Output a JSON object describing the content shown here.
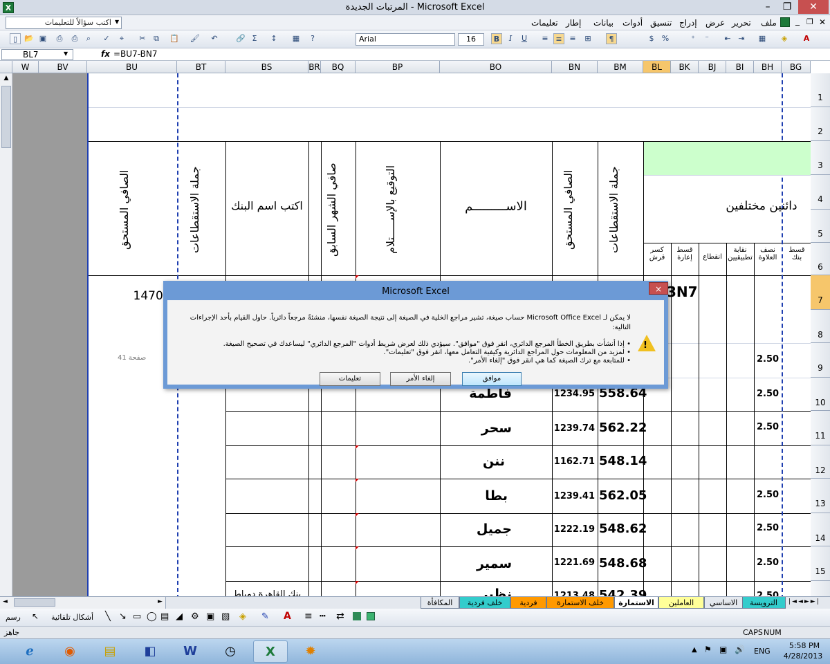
{
  "window": {
    "title": "المرتبات الجديدة - Microsoft Excel",
    "app_icon": "X",
    "min": "–",
    "max": "❐",
    "close": "✕"
  },
  "menu": {
    "items": [
      "ملف",
      "تحرير",
      "عرض",
      "إدراج",
      "تنسيق",
      "أدوات",
      "بيانات",
      "إطار",
      "تعليمات"
    ],
    "ask_placeholder": "اكتب سؤالاً للتعليمات"
  },
  "toolbar": {
    "font": "Arial",
    "size": "16",
    "bold": "B",
    "italic": "I",
    "underline": "U",
    "currency": "$",
    "percent": "%",
    "sum": "Σ"
  },
  "formula_bar": {
    "name_box": "BL7",
    "fx": "fx",
    "formula": "=BU7-BN7"
  },
  "columns": [
    {
      "id": "W",
      "label": "W"
    },
    {
      "id": "BV",
      "label": "BV"
    },
    {
      "id": "BU",
      "label": "BU"
    },
    {
      "id": "BT",
      "label": "BT"
    },
    {
      "id": "BS",
      "label": "BS"
    },
    {
      "id": "BR",
      "label": "BR"
    },
    {
      "id": "BQ",
      "label": "BQ"
    },
    {
      "id": "BP",
      "label": "BP"
    },
    {
      "id": "BO",
      "label": "BO"
    },
    {
      "id": "BN",
      "label": "BN"
    },
    {
      "id": "BM",
      "label": "BM"
    },
    {
      "id": "BL",
      "label": "BL"
    },
    {
      "id": "BK",
      "label": "BK"
    },
    {
      "id": "BJ",
      "label": "BJ"
    },
    {
      "id": "BI",
      "label": "BI"
    },
    {
      "id": "BH",
      "label": "BH"
    },
    {
      "id": "BG",
      "label": "BG"
    }
  ],
  "rows": [
    "1",
    "2",
    "3",
    "4",
    "5",
    "6",
    "7",
    "8",
    "9",
    "10",
    "11",
    "12",
    "13",
    "14",
    "15"
  ],
  "headers": {
    "net_due_bu": "الصافي المستحق",
    "total_deductions_bt": "جملة الاستقطاعات",
    "bank_name": "اكتب اسم البنك",
    "net_prev_month": "صافي الشهر السابق",
    "receipt_signature": "التوقيع بالإســـــتلام",
    "name_header": "الاســـــــــم",
    "net_due_bn": "الصافي المستحق",
    "total_deductions_bm": "جملة الاستقطاعات",
    "creditors": "دائنين مختلفين",
    "loan_break": "كسر قرش",
    "rent_installment": "قسط إعارة",
    "cutoff": "انقطاع",
    "applied_union": "نقابة تطبيقيين",
    "half_bonus": "نصف العلاوة",
    "bank_installment": "قسط بنك"
  },
  "cells": {
    "bu7": "1470.0",
    "bl7_partial": "3N7",
    "page_label": "صفحة 41",
    "bs16_partial": "بنك القاهرة دمياط",
    "row16_name_partial": "نظير"
  },
  "data_rows": [
    {
      "row": "9",
      "name": "",
      "bn": "",
      "bm": "",
      "bh": "2.50"
    },
    {
      "row": "10",
      "name": "فاطمة",
      "bn": "1234.95",
      "bm": "558.64",
      "bh": "2.50"
    },
    {
      "row": "11",
      "name": "سحر",
      "bn": "1239.74",
      "bm": "562.22",
      "bh": "2.50"
    },
    {
      "row": "12",
      "name": "ننن",
      "bn": "1162.71",
      "bm": "548.14",
      "bh": ""
    },
    {
      "row": "13",
      "name": "بطا",
      "bn": "1239.41",
      "bm": "562.05",
      "bh": "2.50"
    },
    {
      "row": "14",
      "name": "جميل",
      "bn": "1222.19",
      "bm": "548.62",
      "bh": "2.50"
    },
    {
      "row": "15",
      "name": "سمير",
      "bn": "1221.69",
      "bm": "548.68",
      "bh": "2.50"
    },
    {
      "row": "16",
      "name": "",
      "bn": "1213.48",
      "bm": "542.39",
      "bh": "2.50"
    }
  ],
  "dialog": {
    "title": "Microsoft Excel",
    "close": "×",
    "line1": "لا يمكن لـ Microsoft Office Excel حساب صيغة، تشير مراجع الخلية في الصيغة إلى نتيجة الصيغة نفسها، منشئةً مرجعاً دائرياً. حاول القيام بأحد الإجراءات",
    "line2": "التالية:",
    "bullet1": "• إذا أنشأت بطريق الخطأ المرجع الدائري، انقر فوق \"موافق\". سيؤدي ذلك لعرض شريط أدوات \"المرجع الدائري\" ليساعدك في تصحيح الصيغة.",
    "bullet2": "• لمزيد من المعلومات حول المراجع الدائرية وكيفية التعامل معها، انقر فوق \"تعليمات\".",
    "bullet3": "• للمتابعة مع ترك الصيغة كما هي انقر فوق \"إلغاء الأمر\".",
    "ok": "موافق",
    "cancel": "إلغاء الأمر",
    "help": "تعليمات"
  },
  "sheet_tabs": [
    "الترويسة",
    "الاساسي",
    "العاملين",
    "الاستمارة",
    "خلف الاستمارة",
    "فردية",
    "خلف فردية",
    "المكافأة"
  ],
  "active_tab": "الاستمارة",
  "drawbar": {
    "draw": "رسم",
    "autoshapes": "أشكال تلقائية"
  },
  "status": {
    "ready": "جاهز",
    "caps": "CAPS",
    "num": "NUM"
  },
  "taskbar": {
    "apps": [
      "ie-icon",
      "firefox-icon",
      "explorer-icon",
      "presentation-icon",
      "word-icon",
      "clock-icon",
      "excel-icon",
      "paint-icon"
    ],
    "lang": "ENG",
    "time": "5:58 PM",
    "date": "4/28/2013"
  }
}
